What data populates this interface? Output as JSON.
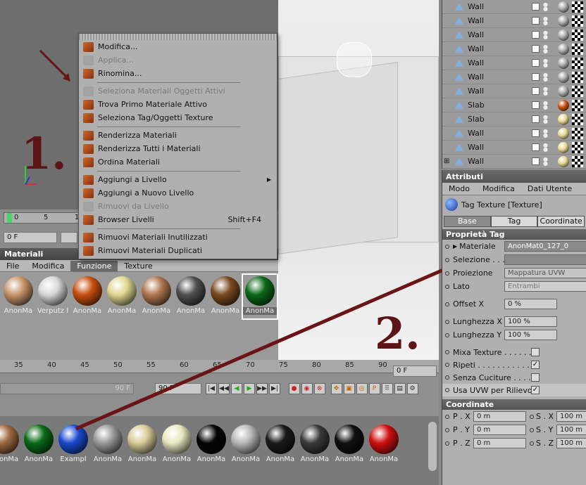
{
  "context_menu": {
    "items": [
      {
        "label": "Modifica...",
        "enabled": true
      },
      {
        "label": "Applica...",
        "enabled": false
      },
      {
        "label": "Rinomina...",
        "enabled": true
      },
      {
        "sep": true
      },
      {
        "label": "Seleziona Materiali Oggetti Attivi",
        "enabled": false
      },
      {
        "label": "Trova Primo Materiale Attivo",
        "enabled": true
      },
      {
        "label": "Seleziona Tag/Oggetti Texture",
        "enabled": true
      },
      {
        "sep": true
      },
      {
        "label": "Renderizza Materiali",
        "enabled": true
      },
      {
        "label": "Renderizza Tutti i Materiali",
        "enabled": true
      },
      {
        "label": "Ordina Materiali",
        "enabled": true
      },
      {
        "sep": true
      },
      {
        "label": "Aggiungi a Livello",
        "enabled": true,
        "submenu": true
      },
      {
        "label": "Aggiungi a Nuovo Livello",
        "enabled": true
      },
      {
        "label": "Rimuovi da Livello",
        "enabled": false
      },
      {
        "label": "Browser Livelli",
        "enabled": true,
        "shortcut": "Shift+F4"
      },
      {
        "sep": true
      },
      {
        "label": "Rimuovi Materiali Inutilizzati",
        "enabled": true
      },
      {
        "label": "Rimuovi Materiali Duplicati",
        "enabled": true
      }
    ]
  },
  "annotations": {
    "step1": "1.",
    "step2": "2."
  },
  "timeline": {
    "ruler_top": [
      "0",
      "5",
      "1"
    ],
    "frame_field": "0 F"
  },
  "material_panel": {
    "title": "Materiali",
    "menu": [
      "File",
      "Modifica",
      "Funzione",
      "Texture"
    ],
    "active_menu": "Funzione",
    "materials": [
      {
        "label": "AnonMa",
        "color": "#c8956a"
      },
      {
        "label": "Verputz I",
        "color": "#d8d8d8"
      },
      {
        "label": "AnonMa",
        "color": "#c85010"
      },
      {
        "label": "AnonMa",
        "color": "#e0d890"
      },
      {
        "label": "AnonMa",
        "color": "#b07850"
      },
      {
        "label": "AnonMa",
        "color": "#505050"
      },
      {
        "label": "AnonMa",
        "color": "#7a4a20"
      },
      {
        "label": "AnonMa",
        "color": "#0a6a18",
        "selected": true
      }
    ]
  },
  "bottom_timeline": {
    "ticks": [
      "35",
      "40",
      "45",
      "50",
      "55",
      "60",
      "65",
      "70",
      "75",
      "80",
      "85",
      "90"
    ],
    "frame_field": "0 F",
    "field_90": "90 F",
    "field_90b": "90 F"
  },
  "bottom_materials": [
    {
      "label": "AnonMa",
      "color": "#a06a40"
    },
    {
      "label": "AnonMa",
      "color": "#0a6a18"
    },
    {
      "label": "Exampl",
      "color": "#1a4ad0"
    },
    {
      "label": "AnonMa",
      "color": "#9a9a9a"
    },
    {
      "label": "AnonMa",
      "color": "#d8cc98"
    },
    {
      "label": "AnonMa",
      "color": "#e8e8c0"
    },
    {
      "label": "AnonMa",
      "color": "#050505"
    },
    {
      "label": "AnonMa",
      "color": "#b8b8b8"
    },
    {
      "label": "AnonMa",
      "color": "#1a1a1a"
    },
    {
      "label": "AnonMa",
      "color": "#3a3a3a"
    },
    {
      "label": "AnonMa",
      "color": "#101010"
    },
    {
      "label": "AnonMa",
      "color": "#d01010"
    }
  ],
  "objects": [
    {
      "name": "Wall",
      "color": "#aaaaaa"
    },
    {
      "name": "Wall",
      "color": "#aaaaaa"
    },
    {
      "name": "Wall",
      "color": "#aaaaaa"
    },
    {
      "name": "Wall",
      "color": "#aaaaaa"
    },
    {
      "name": "Wall",
      "color": "#aaaaaa"
    },
    {
      "name": "Wall",
      "color": "#aaaaaa"
    },
    {
      "name": "Wall",
      "color": "#aaaaaa"
    },
    {
      "name": "Slab",
      "color": "#c85010"
    },
    {
      "name": "Slab",
      "color": "#e8d890"
    },
    {
      "name": "Wall",
      "color": "#e8d890"
    },
    {
      "name": "Wall",
      "color": "#e8d890"
    },
    {
      "name": "Wall",
      "color": "#e8d890"
    }
  ],
  "attributes": {
    "title": "Attributi",
    "menu": [
      "Modo",
      "Modifica",
      "Dati Utente"
    ],
    "tag_title": "Tag Texture [Texture]",
    "tabs": [
      "Base",
      "Tag",
      "Coordinate"
    ],
    "active_tab": "Tag",
    "section_tag": "Proprietà Tag",
    "materiale_label": "Materiale",
    "materiale_value": "AnonMat0_127_0",
    "selezione_label": "Selezione . . .",
    "proiezione_label": "Proiezione",
    "proiezione_value": "Mappatura UVW",
    "lato_label": "Lato",
    "lato_value": "Entrambi",
    "offset_x_label": "Offset X",
    "offset_x_value": "0 %",
    "lunghezza_x_label": "Lunghezza X",
    "lunghezza_x_value": "100 %",
    "lunghezza_y_label": "Lunghezza Y",
    "lunghezza_y_value": "100 %",
    "mixa_label": "Mixa Texture . . . . . .",
    "ripeti_label": "Ripeti . . . . . . . . . . . .",
    "cuciture_label": "Senza Cuciture . . . . .",
    "usa_uvw_label": "Usa UVW per Rilievo",
    "ripeti_checked": true,
    "usa_uvw_checked": true,
    "section_coord": "Coordinate",
    "px_label": "P . X",
    "px_value": "0 m",
    "py_label": "P . Y",
    "py_value": "0 m",
    "pz_label": "P . Z",
    "pz_value": "0 m",
    "sx_label": "S . X",
    "sx_value": "100 m",
    "sy_label": "S . Y",
    "sy_value": "100 m",
    "sz_label": "S . Z",
    "sz_value": "100 m"
  }
}
